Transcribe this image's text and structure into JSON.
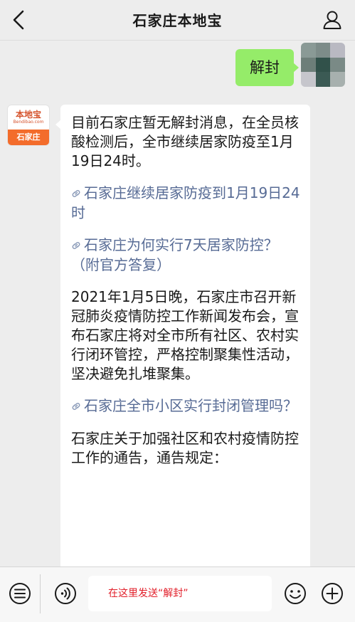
{
  "header": {
    "title": "石家庄本地宝"
  },
  "outgoing": {
    "text": "解封"
  },
  "bot_avatar": {
    "brand": "本地宝",
    "url": "Bendibao.com",
    "city": "石家庄"
  },
  "incoming": {
    "blocks": [
      {
        "type": "text",
        "text": "目前石家庄暂无解封消息，在全员核酸检测后，全市继续居家防疫至1月19日24时。"
      },
      {
        "type": "link",
        "text": "石家庄继续居家防疫到1月19日24时"
      },
      {
        "type": "link",
        "text": "石家庄为何实行7天居家防控？（附官方答复）"
      },
      {
        "type": "text",
        "text": "2021年1月5日晚，石家庄市召开新冠肺炎疫情防控工作新闻发布会，宣布石家庄将对全市所有社区、农村实行闭环管控，严格控制聚集性活动，坚决避免扎堆聚集。"
      },
      {
        "type": "link",
        "text": "石家庄全市小区实行封闭管理吗？"
      },
      {
        "type": "text",
        "text": "石家庄关于加强社区和农村疫情防控工作的通告，通告规定："
      }
    ]
  },
  "toolbar": {
    "input_text": "在这里发送“解封”",
    "input_color": "#e2202b"
  },
  "colors": {
    "bubble_out": "#95ec69",
    "link": "#576b95",
    "brand_orange": "#f36c2b"
  }
}
